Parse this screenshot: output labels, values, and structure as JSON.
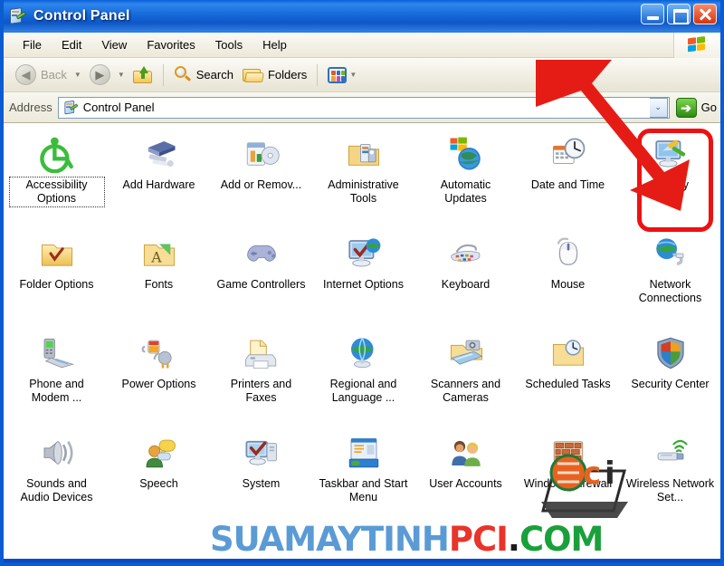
{
  "window": {
    "title": "Control Panel",
    "title_icon": "control-panel-icon",
    "buttons": {
      "minimize": "_",
      "maximize": "□",
      "close": "✕"
    }
  },
  "menubar": {
    "items": [
      {
        "label": "File"
      },
      {
        "label": "Edit"
      },
      {
        "label": "View"
      },
      {
        "label": "Favorites"
      },
      {
        "label": "Tools"
      },
      {
        "label": "Help"
      }
    ],
    "brand_icon": "windows-flag-icon"
  },
  "toolbar": {
    "back_label": "Back",
    "back_icon": "back-arrow-icon",
    "forward_icon": "forward-arrow-icon",
    "up_icon": "up-folder-icon",
    "search_label": "Search",
    "search_icon": "magnifier-icon",
    "folders_label": "Folders",
    "folders_icon": "folder-icon",
    "views_icon": "views-grid-icon",
    "views_caret": "▼"
  },
  "address": {
    "label": "Address",
    "value": "Control Panel",
    "placeholder": "Control Panel",
    "icon": "control-panel-icon",
    "dropdown_caret": "⌄",
    "go_label": "Go",
    "go_icon": "go-arrow-icon"
  },
  "colors": {
    "titlebar_blue": "#1567d8",
    "window_border": "#0b5bd3",
    "toolbar_beige": "#ece9d8",
    "highlight_red": "#ee1111",
    "arrow_red": "#e51c15",
    "watermark_blue": "#5b9bd5",
    "watermark_red": "#e8342a",
    "watermark_green": "#1aa03a"
  },
  "annotations": {
    "arrow": {
      "name": "red-arrow-pointer",
      "target": "Display",
      "direction": "down-right"
    },
    "highlight": {
      "name": "red-highlight-box",
      "target": "Display"
    }
  },
  "watermark": {
    "part1": "SUAMAYTINH",
    "part2": "PCI",
    "part3": ".",
    "part4": "COM",
    "logo": "pci-logo"
  },
  "items": [
    {
      "label": "Accessibility Options",
      "icon": "accessibility-icon",
      "selected": true,
      "highlight": false
    },
    {
      "label": "Add Hardware",
      "icon": "add-hardware-icon",
      "selected": false,
      "highlight": false
    },
    {
      "label": "Add or Remov...",
      "icon": "add-remove-programs-icon",
      "selected": false,
      "highlight": false
    },
    {
      "label": "Administrative Tools",
      "icon": "administrative-tools-icon",
      "selected": false,
      "highlight": false
    },
    {
      "label": "Automatic Updates",
      "icon": "automatic-updates-icon",
      "selected": false,
      "highlight": false
    },
    {
      "label": "Date and Time",
      "icon": "date-time-icon",
      "selected": false,
      "highlight": false
    },
    {
      "label": "Display",
      "icon": "display-icon",
      "selected": false,
      "highlight": true
    },
    {
      "label": "Folder Options",
      "icon": "folder-options-icon",
      "selected": false,
      "highlight": false
    },
    {
      "label": "Fonts",
      "icon": "fonts-icon",
      "selected": false,
      "highlight": false
    },
    {
      "label": "Game Controllers",
      "icon": "game-controllers-icon",
      "selected": false,
      "highlight": false
    },
    {
      "label": "Internet Options",
      "icon": "internet-options-icon",
      "selected": false,
      "highlight": false
    },
    {
      "label": "Keyboard",
      "icon": "keyboard-icon",
      "selected": false,
      "highlight": false
    },
    {
      "label": "Mouse",
      "icon": "mouse-icon",
      "selected": false,
      "highlight": false
    },
    {
      "label": "Network Connections",
      "icon": "network-connections-icon",
      "selected": false,
      "highlight": false
    },
    {
      "label": "Phone and Modem ...",
      "icon": "phone-modem-icon",
      "selected": false,
      "highlight": false
    },
    {
      "label": "Power Options",
      "icon": "power-options-icon",
      "selected": false,
      "highlight": false
    },
    {
      "label": "Printers and Faxes",
      "icon": "printers-faxes-icon",
      "selected": false,
      "highlight": false
    },
    {
      "label": "Regional and Language ...",
      "icon": "regional-language-icon",
      "selected": false,
      "highlight": false
    },
    {
      "label": "Scanners and Cameras",
      "icon": "scanners-cameras-icon",
      "selected": false,
      "highlight": false
    },
    {
      "label": "Scheduled Tasks",
      "icon": "scheduled-tasks-icon",
      "selected": false,
      "highlight": false
    },
    {
      "label": "Security Center",
      "icon": "security-center-icon",
      "selected": false,
      "highlight": false
    },
    {
      "label": "Sounds and Audio Devices",
      "icon": "sounds-audio-icon",
      "selected": false,
      "highlight": false
    },
    {
      "label": "Speech",
      "icon": "speech-icon",
      "selected": false,
      "highlight": false
    },
    {
      "label": "System",
      "icon": "system-icon",
      "selected": false,
      "highlight": false
    },
    {
      "label": "Taskbar and Start Menu",
      "icon": "taskbar-start-menu-icon",
      "selected": false,
      "highlight": false
    },
    {
      "label": "User Accounts",
      "icon": "user-accounts-icon",
      "selected": false,
      "highlight": false
    },
    {
      "label": "Windows Firewall",
      "icon": "windows-firewall-icon",
      "selected": false,
      "highlight": false
    },
    {
      "label": "Wireless Network Set...",
      "icon": "wireless-network-setup-icon",
      "selected": false,
      "highlight": false
    }
  ]
}
